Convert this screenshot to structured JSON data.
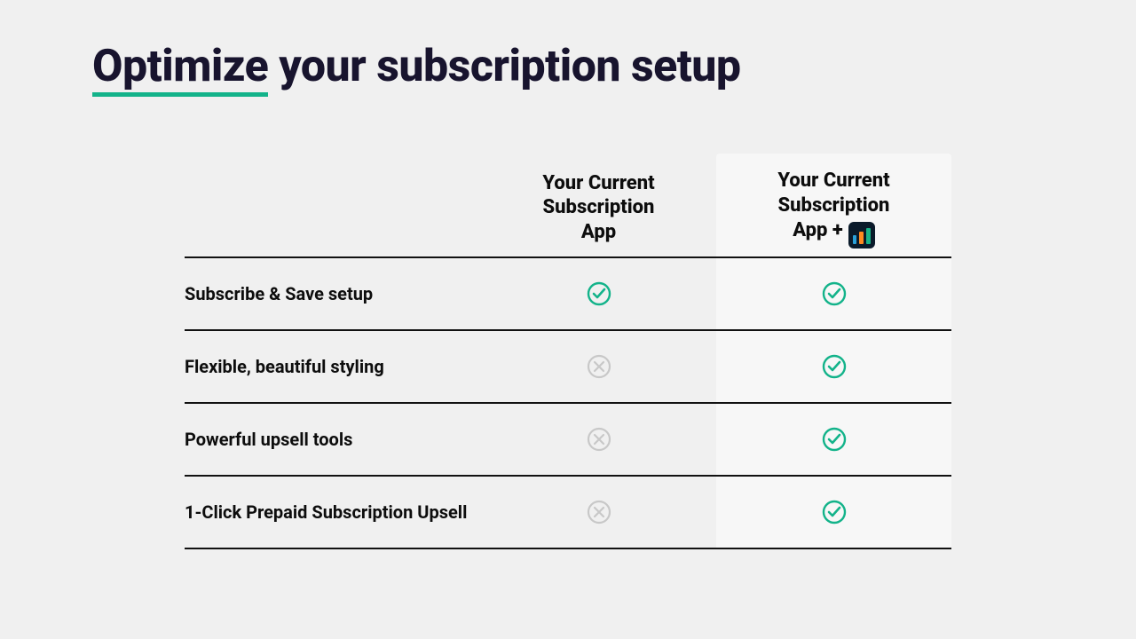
{
  "title_highlight": "Optimize",
  "title_rest": " your subscription setup",
  "columns": {
    "col1_line1": "Your Current",
    "col1_line2": "Subscription",
    "col1_line3": "App",
    "col2_line1": "Your Current",
    "col2_line2": "Subscription",
    "col2_line3_prefix": "App +"
  },
  "rows": [
    {
      "feature": "Subscribe & Save setup",
      "col1": "check",
      "col2": "check"
    },
    {
      "feature": "Flexible, beautiful styling",
      "col1": "x",
      "col2": "check"
    },
    {
      "feature": "Powerful upsell tools",
      "col1": "x",
      "col2": "check"
    },
    {
      "feature": "1-Click Prepaid Subscription Upsell",
      "col1": "x",
      "col2": "check"
    }
  ],
  "colors": {
    "accent": "#13b38a",
    "text": "#18142e",
    "muted": "#c8c8c8"
  }
}
